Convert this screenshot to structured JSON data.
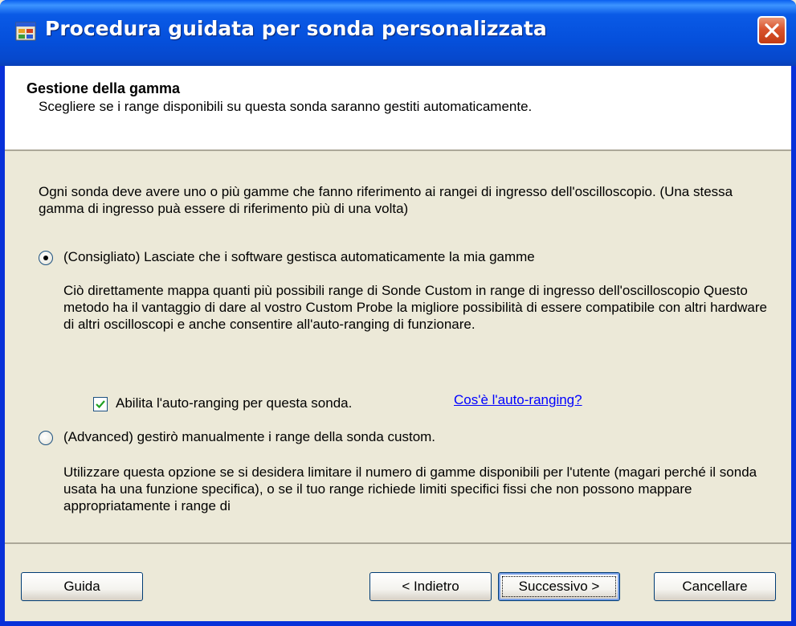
{
  "window": {
    "title": "Procedura guidata per sonda personalizzata",
    "app_icon": "window-app-icon",
    "close_icon": "close-icon"
  },
  "header": {
    "title": "Gestione della gamma",
    "description": "Scegliere se i range disponibili su questa sonda saranno gestiti automaticamente."
  },
  "content": {
    "intro": "Ogni sonda deve avere uno o più gamme che fanno riferimento ai rangei di ingresso dell'oscilloscopio. (Una  stessa gamma di ingresso puà essere di riferimento più di una volta)",
    "option_auto": {
      "label": "(Consigliato) Lasciate che i software gestisca automaticamente la mia gamme",
      "selected": true,
      "description": "Ciò direttamente mappa quanti più possibili range di Sonde Custom in range di ingresso dell'oscilloscopio  Questo metodo ha il vantaggio di dare al vostro Custom Probe la migliore possibilità di essere compatibile con altri hardware di altri oscilloscopi e anche consentire all'auto-ranging di funzionare."
    },
    "autoranging_checkbox": {
      "label": "Abilita l'auto-ranging per questa sonda.",
      "checked": true
    },
    "autoranging_link": "Cos'è l'auto-ranging?",
    "option_manual": {
      "label": "(Advanced) gestirò manualmente i range della sonda custom.",
      "selected": false,
      "description": "Utilizzare questa opzione se si desidera limitare il numero di gamme disponibili per l'utente (magari perché il sonda usata ha una funzione specifica), o se il tuo range richiede limiti specifici fissi che non possono mappare appropriatamente i range di"
    }
  },
  "footer": {
    "help_label": "Guida",
    "back_label": "< Indietro",
    "next_label": "Successivo >",
    "cancel_label": "Cancellare"
  },
  "colors": {
    "titlebar": "#0550dc",
    "dialog_bg": "#ece9d8",
    "link": "#0000ff",
    "close_button": "#d9542e"
  }
}
